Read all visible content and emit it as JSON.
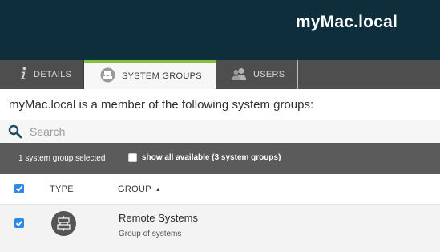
{
  "header": {
    "title": "myMac.local"
  },
  "tabs": {
    "details": {
      "label": "DETAILS",
      "icon": "info-icon"
    },
    "system_groups": {
      "label": "SYSTEM GROUPS",
      "icon": "system-groups-icon",
      "active": true
    },
    "users": {
      "label": "USERS",
      "icon": "users-icon"
    }
  },
  "intro_text": "myMac.local is a member of the following system groups:",
  "search": {
    "placeholder": "Search",
    "value": "",
    "icon": "search-icon"
  },
  "selection_bar": {
    "count_text": "1 system group selected",
    "show_all_label": "show all available (3 system groups)",
    "show_all_checked": false
  },
  "table": {
    "select_all_checked": true,
    "columns": {
      "type": "TYPE",
      "group": "GROUP"
    },
    "sort": {
      "column": "group",
      "direction": "ascending"
    },
    "rows": [
      {
        "checked": true,
        "type_icon": "system-group-icon",
        "name": "Remote Systems",
        "description": "Group of systems"
      }
    ]
  },
  "colors": {
    "header_bg": "#0e2e3b",
    "tabbar_bg": "#4e4e4e",
    "active_tab_accent": "#7fc241",
    "selection_bar_bg": "#5b5b5b",
    "checkbox_blue": "#2f8ae5",
    "search_icon": "#1d4e63"
  }
}
